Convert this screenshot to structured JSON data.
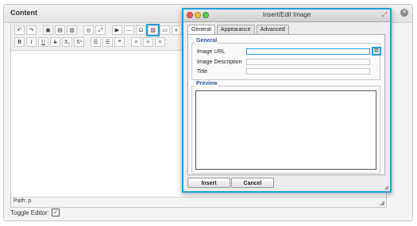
{
  "panel": {
    "title": "Content",
    "close_icon": "close-icon"
  },
  "editor": {
    "toolbar_row1": [
      "undo-icon",
      "redo-icon",
      "paste-word-icon",
      "paste-icon",
      "paste-text-icon",
      "find-icon",
      "fullscreen-icon",
      "media-icon",
      "hr-icon",
      "charmap-icon",
      "image-icon",
      "insert-icon",
      "more-icon"
    ],
    "toolbar_row2": [
      {
        "icon": "bold-icon",
        "label": "B"
      },
      {
        "icon": "italic-icon",
        "label": "I"
      },
      {
        "icon": "underline-icon",
        "label": "U"
      },
      {
        "icon": "strikethrough-icon",
        "label": "S"
      },
      {
        "icon": "subscript-icon",
        "label": "X₂"
      },
      {
        "icon": "superscript-icon",
        "label": "X²"
      },
      {
        "icon": "bullist-icon",
        "label": "☰"
      },
      {
        "icon": "numlist-icon",
        "label": "☰"
      },
      {
        "icon": "blockquote-icon",
        "label": "❝"
      },
      {
        "icon": "align-left-icon",
        "label": "≡"
      },
      {
        "icon": "align-center-icon",
        "label": "≡"
      },
      {
        "icon": "align-right-icon",
        "label": "≡"
      }
    ],
    "path": "Path: p",
    "toggle_label": "Toggle Editor:",
    "toggle_checked": true
  },
  "dialog": {
    "title": "Insert/Edit Image",
    "tabs": [
      "General",
      "Appearance",
      "Advanced"
    ],
    "active_tab": "General",
    "general_legend": "General",
    "fields": [
      {
        "label": "Image URL",
        "value": ""
      },
      {
        "label": "Image Description",
        "value": ""
      },
      {
        "label": "Title",
        "value": ""
      }
    ],
    "preview_legend": "Preview",
    "insert_label": "Insert",
    "cancel_label": "Cancel"
  },
  "colors": {
    "highlight": "#1fa0dc",
    "legend": "#2a5aa8"
  }
}
